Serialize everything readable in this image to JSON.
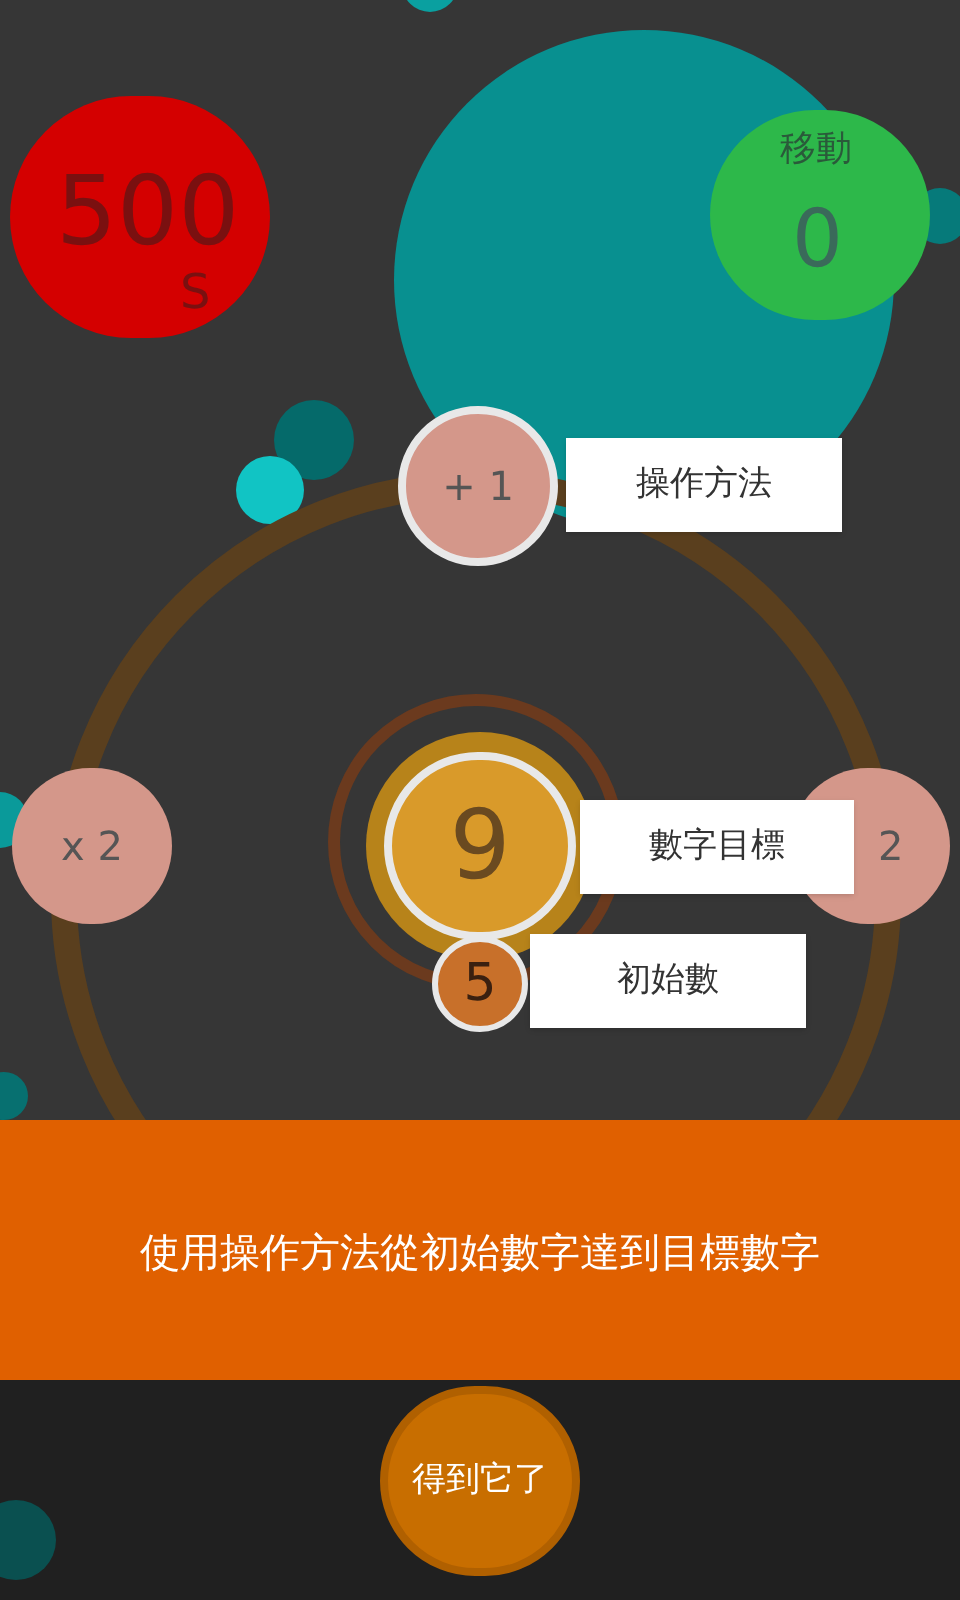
{
  "score": {
    "value": "500",
    "unit": "S"
  },
  "moves": {
    "label": "移動",
    "value": "0"
  },
  "operators": [
    {
      "label": "+ 1"
    },
    {
      "label": "x 2"
    },
    {
      "label": "2"
    }
  ],
  "target": {
    "value": "9"
  },
  "start": {
    "value": "5"
  },
  "callouts": [
    {
      "text": "操作方法"
    },
    {
      "text": "數字目標"
    },
    {
      "text": "初始數"
    }
  ],
  "instruction": "使用操作方法從初始數字達到目標數字",
  "button": {
    "label": "得到它了"
  }
}
